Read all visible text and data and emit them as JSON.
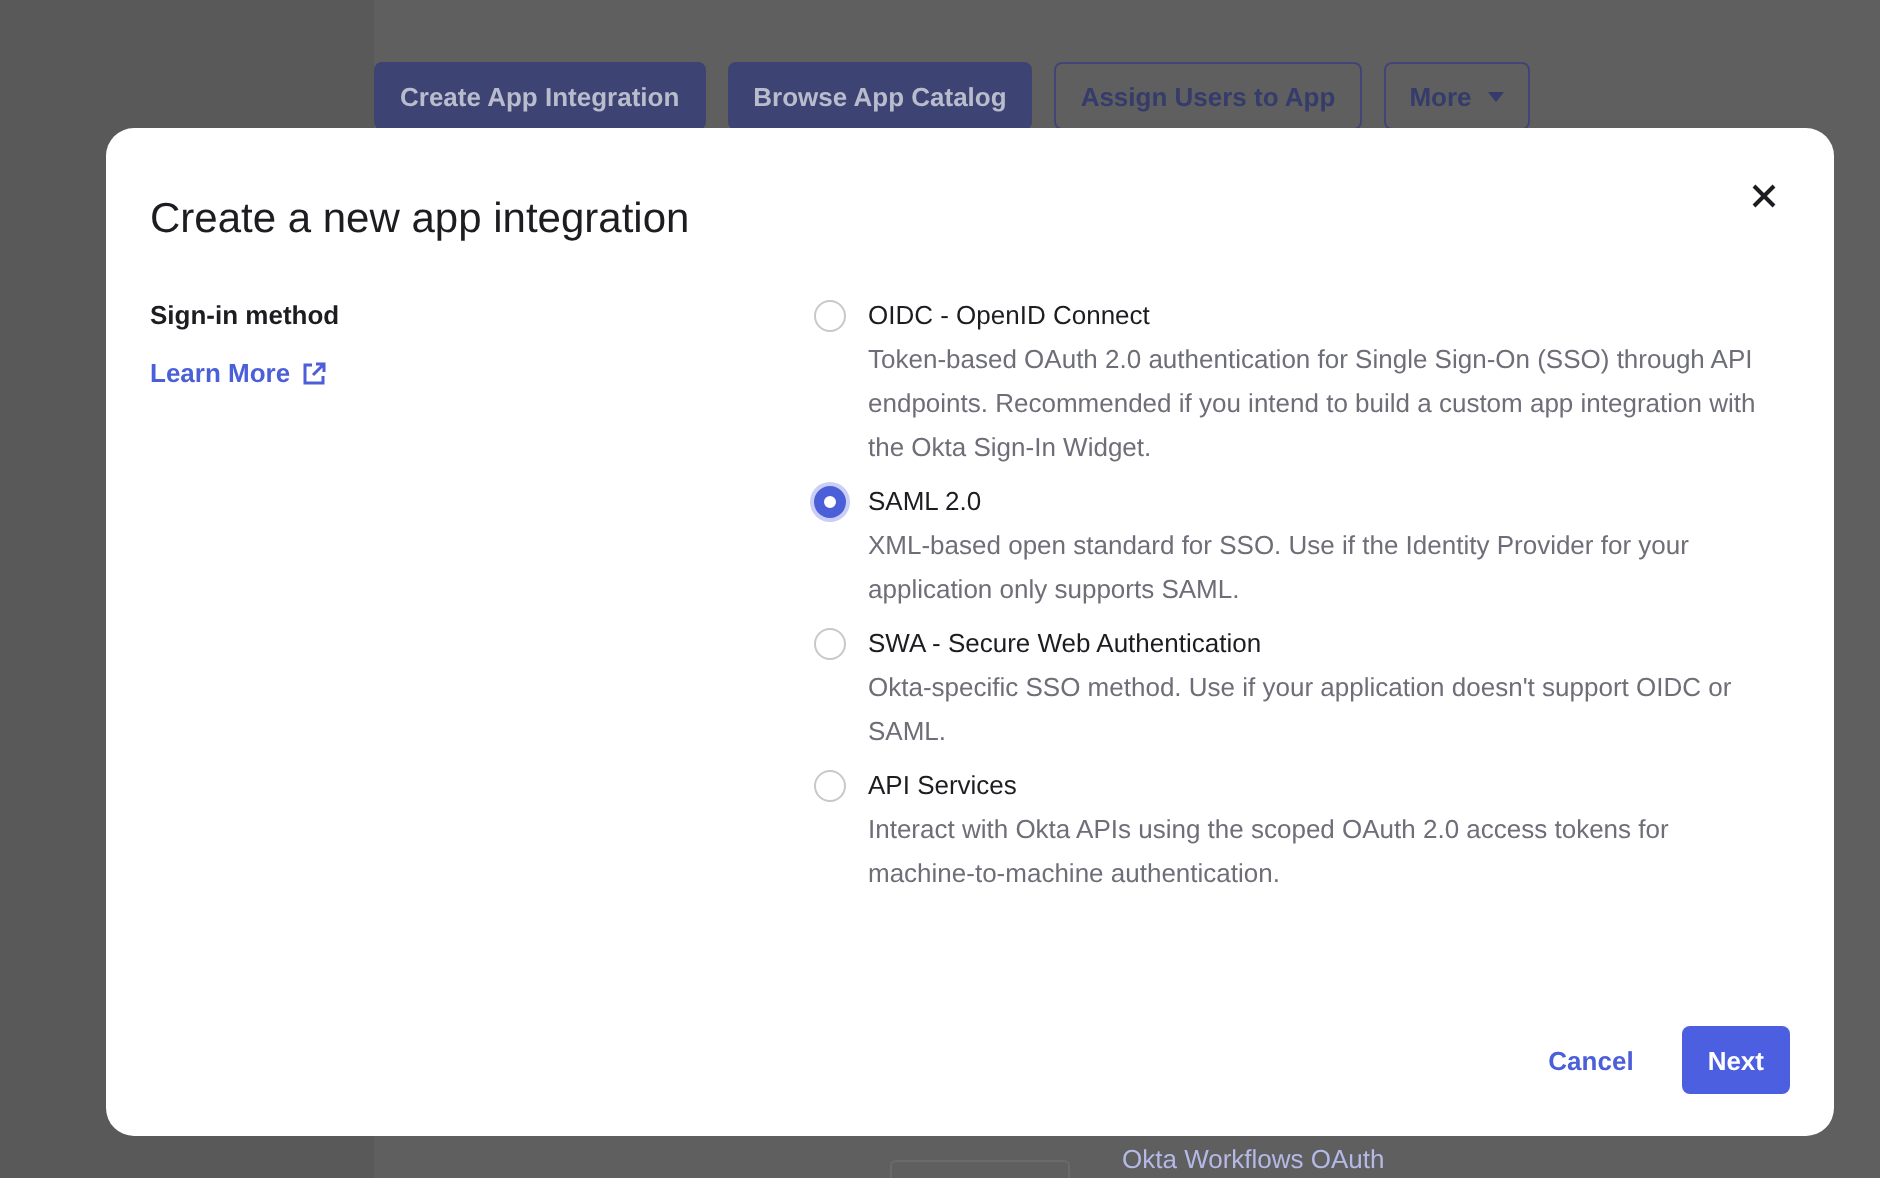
{
  "page_toolbar": [
    {
      "label": "Create App Integration",
      "kind": "filled"
    },
    {
      "label": "Browse App Catalog",
      "kind": "filled"
    },
    {
      "label": "Assign Users to App",
      "kind": "outline"
    },
    {
      "label": "More",
      "kind": "dropdown"
    }
  ],
  "background_list_item": "Okta Workflows OAuth",
  "dialog": {
    "title": "Create a new app integration",
    "section_label": "Sign-in method",
    "learn_more": "Learn More",
    "options": [
      {
        "label": "OIDC - OpenID Connect",
        "description": "Token-based OAuth 2.0 authentication for Single Sign-On (SSO) through API endpoints. Recommended if you intend to build a custom app integration with the Okta Sign-In Widget.",
        "selected": false
      },
      {
        "label": "SAML 2.0",
        "description": "XML-based open standard for SSO. Use if the Identity Provider for your application only supports SAML.",
        "selected": true
      },
      {
        "label": "SWA - Secure Web Authentication",
        "description": "Okta-specific SSO method. Use if your application doesn't support OIDC or SAML.",
        "selected": false
      },
      {
        "label": "API Services",
        "description": "Interact with Okta APIs using the scoped OAuth 2.0 access tokens for machine-to-machine authentication.",
        "selected": false
      }
    ],
    "cancel": "Cancel",
    "next": "Next"
  }
}
